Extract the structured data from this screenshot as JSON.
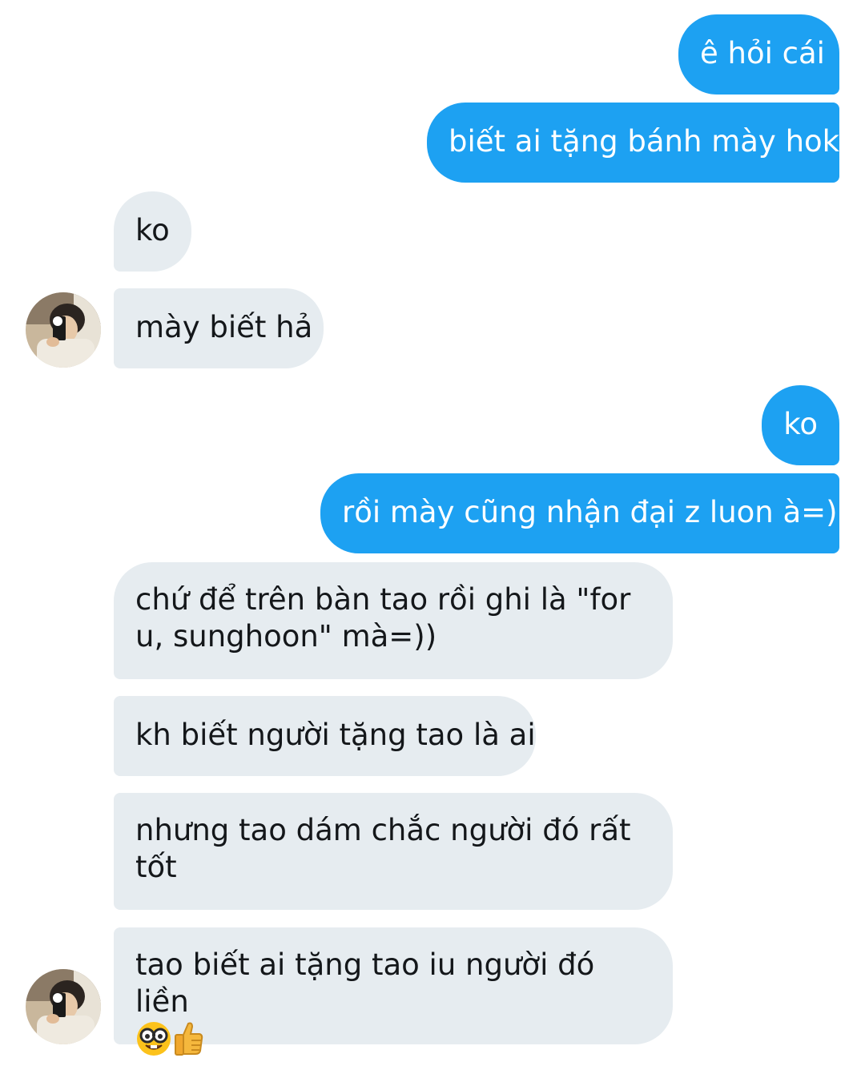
{
  "colors": {
    "sent_bubble": "#1da1f2",
    "received_bubble": "#e6ecf0",
    "sent_text": "#ffffff",
    "received_text": "#14171a"
  },
  "messages": [
    {
      "direction": "sent",
      "text": "ê hỏi cái"
    },
    {
      "direction": "sent",
      "text": "biết ai tặng bánh mày hok"
    },
    {
      "direction": "received",
      "text": "ko"
    },
    {
      "direction": "received",
      "text": "mày biết hả"
    },
    {
      "direction": "sent",
      "text": "ko"
    },
    {
      "direction": "sent",
      "text": "rồi mày cũng nhận đại z luon à=))"
    },
    {
      "direction": "received",
      "text": "chứ để trên bàn tao rồi ghi là \"for u, sunghoon\" mà=))"
    },
    {
      "direction": "received",
      "text": "kh biết người tặng tao là ai"
    },
    {
      "direction": "received",
      "text": "nhưng tao dám chắc người đó rất tốt"
    },
    {
      "direction": "received",
      "text": "tao biết ai tặng tao iu người đó liền",
      "emojis": [
        "nerd-face-emoji",
        "thumbs-up-emoji"
      ]
    }
  ]
}
